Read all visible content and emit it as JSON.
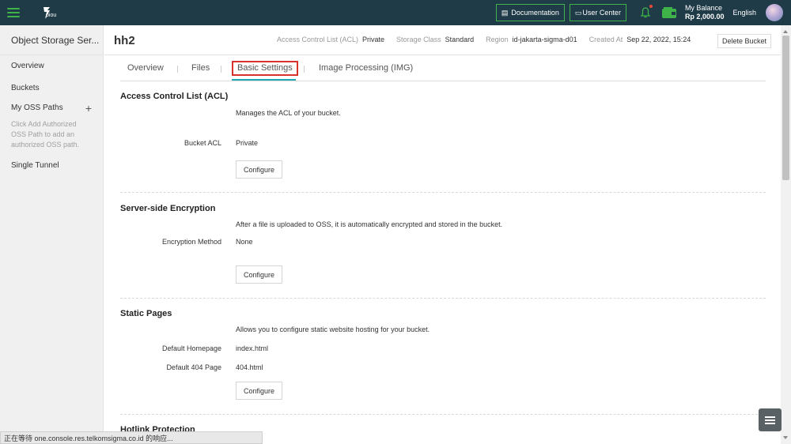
{
  "topbar": {
    "documentation_label": "Documentation",
    "user_center_label": "User Center",
    "balance_label": "My Balance",
    "balance_amount": "Rp 2,000.00",
    "language": "English",
    "logo_text": "piou",
    "accent_color": "#3fb24a"
  },
  "sidebar": {
    "title": "Object Storage Ser...",
    "items": [
      {
        "label": "Overview"
      },
      {
        "label": "Buckets"
      },
      {
        "label": "My OSS Paths"
      },
      {
        "label": "Single Tunnel"
      }
    ],
    "hint": "Click Add Authorized OSS Path to add an authorized OSS path."
  },
  "header": {
    "bucket_name": "hh2",
    "acl_key": "Access Control List (ACL)",
    "acl_value": "Private",
    "storage_key": "Storage Class",
    "storage_value": "Standard",
    "region_key": "Region",
    "region_value": "id-jakarta-sigma-d01",
    "created_key": "Created At",
    "created_value": "Sep 22, 2022, 15:24",
    "delete_label": "Delete Bucket"
  },
  "tabs": [
    {
      "label": "Overview"
    },
    {
      "label": "Files"
    },
    {
      "label": "Basic Settings",
      "active": true
    },
    {
      "label": "Image Processing (IMG)"
    }
  ],
  "sections": {
    "acl": {
      "title": "Access Control List (ACL)",
      "desc": "Manages the ACL of your bucket.",
      "row_label": "Bucket ACL",
      "row_value": "Private",
      "button": "Configure"
    },
    "encryption": {
      "title": "Server-side Encryption",
      "desc": "After a file is uploaded to OSS, it is automatically encrypted and stored in the bucket.",
      "row_label": "Encryption Method",
      "row_value": "None",
      "button": "Configure"
    },
    "static_pages": {
      "title": "Static Pages",
      "desc": "Allows you to configure static website hosting for your bucket.",
      "home_label": "Default Homepage",
      "home_value": "index.html",
      "notfound_label": "Default 404 Page",
      "notfound_value": "404.html",
      "button": "Configure"
    },
    "hotlink": {
      "title": "Hotlink Protection"
    }
  },
  "statusbar": {
    "text": "正在等待 one.console.res.telkomsigma.co.id 的响应..."
  }
}
